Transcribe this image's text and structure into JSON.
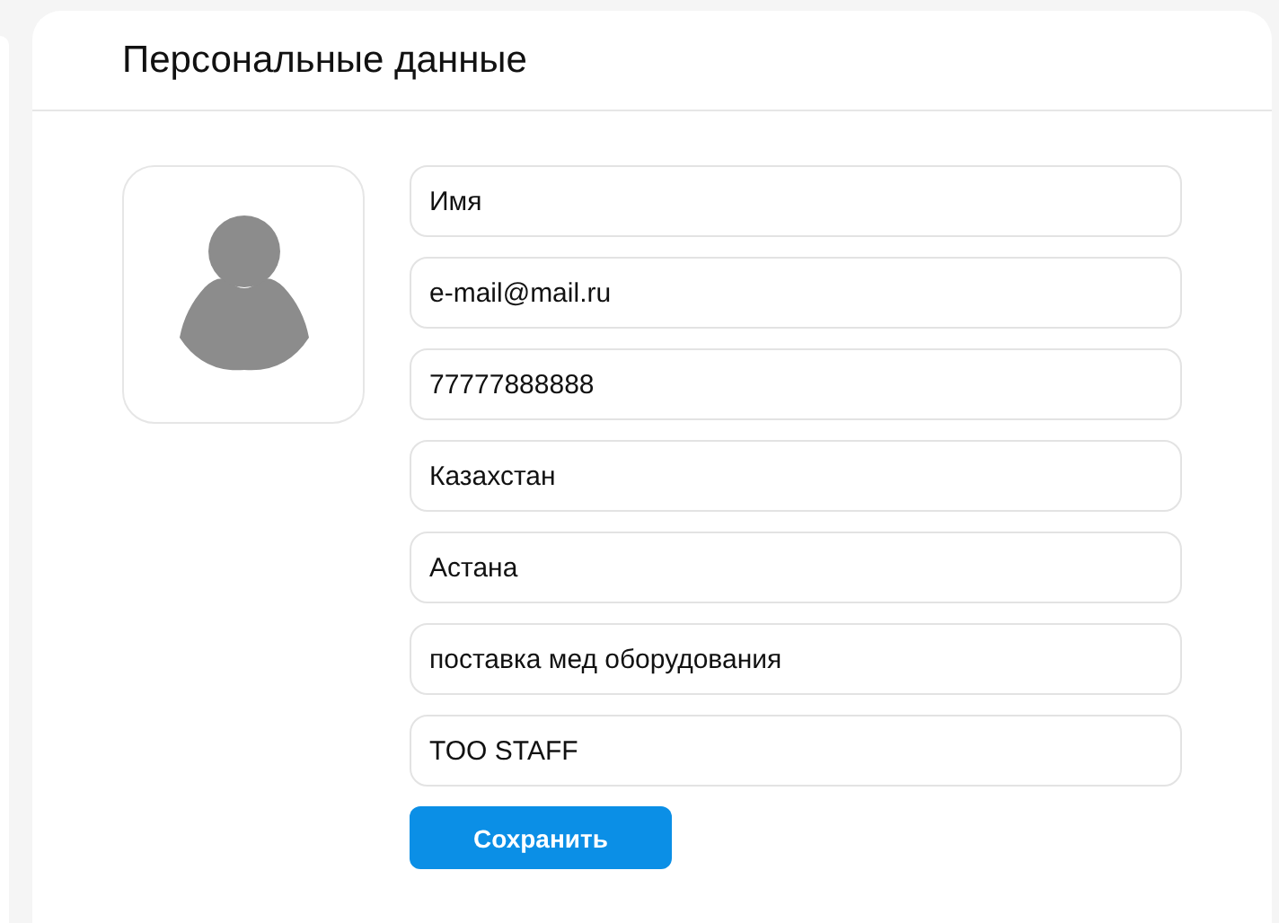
{
  "title": "Персональные данные",
  "fields": [
    {
      "value": "Имя"
    },
    {
      "value": "e-mail@mail.ru"
    },
    {
      "value": "77777888888"
    },
    {
      "value": "Казахстан"
    },
    {
      "value": "Астана"
    },
    {
      "value": "поставка мед оборудования"
    },
    {
      "value": "TOO STAFF"
    }
  ],
  "save_button": "Сохранить"
}
